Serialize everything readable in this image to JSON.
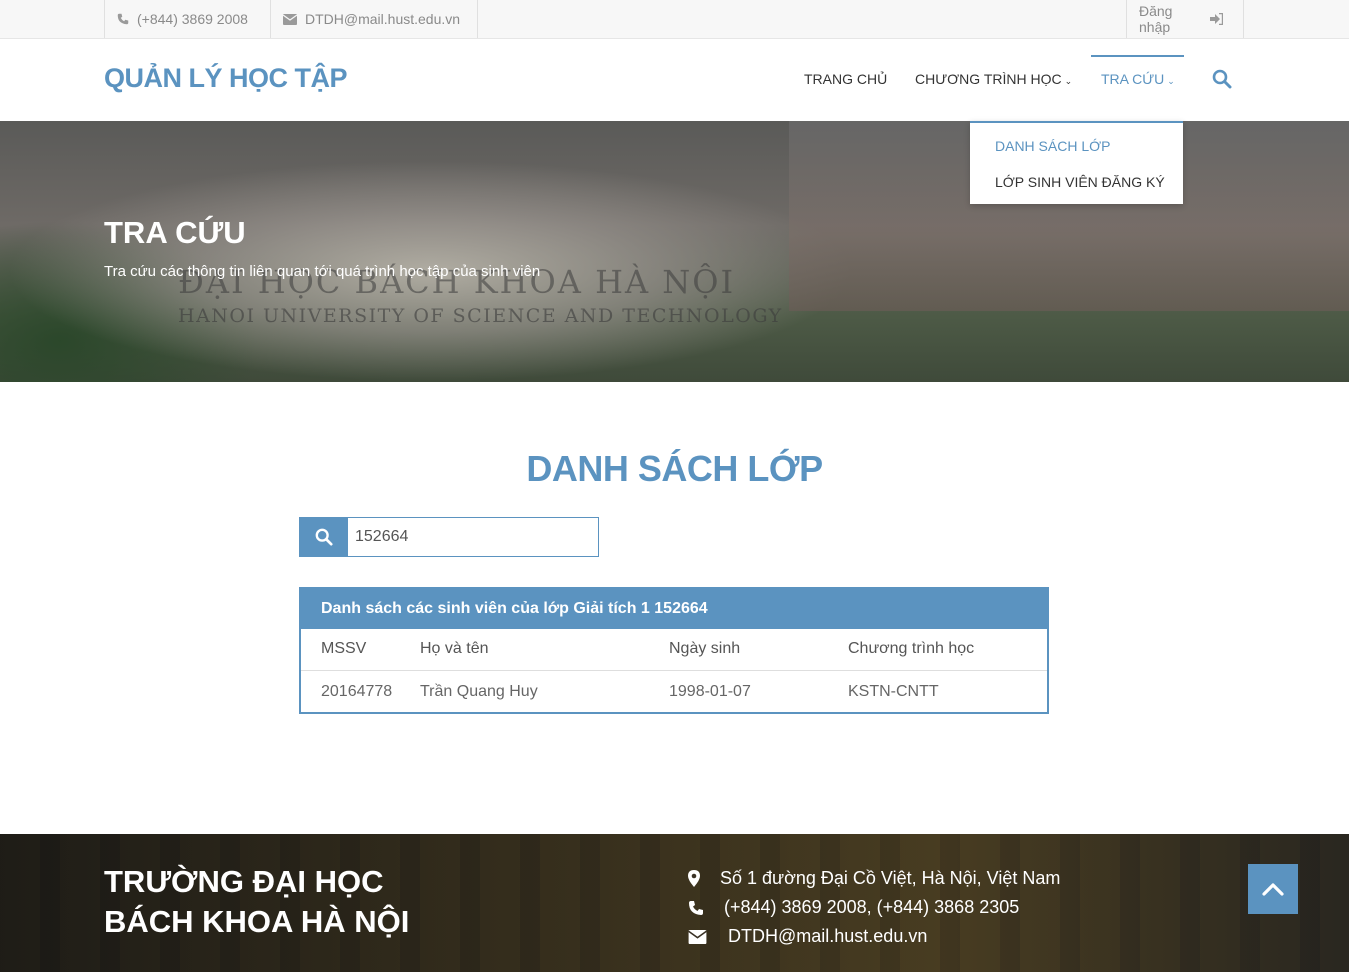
{
  "topbar": {
    "phone": "(+844) 3869 2008",
    "email": "DTDH@mail.hust.edu.vn",
    "login": "Đăng nhập"
  },
  "header": {
    "logo": "QUẢN LÝ HỌC TẬP",
    "nav": {
      "home": "TRANG CHỦ",
      "program": "CHƯƠNG TRÌNH HỌC",
      "lookup": "TRA CỨU"
    }
  },
  "dropdown": {
    "items": [
      "DANH SÁCH LỚP",
      "LỚP SINH VIÊN ĐĂNG KÝ"
    ]
  },
  "hero": {
    "title": "TRA CỨU",
    "subtitle": "Tra cứu các thông tin liên quan tới quá trình học tập của sinh viên",
    "stone_line1": "ĐẠI HỌC BÁCH KHOA HÀ NỘI",
    "stone_line2": "HANOI UNIVERSITY OF SCIENCE AND TECHNOLOGY"
  },
  "main": {
    "title": "DANH SÁCH LỚP",
    "search_value": "152664",
    "panel_title": "Danh sách các sinh viên của lớp Giải tích 1 152664",
    "table": {
      "headers": [
        "MSSV",
        "Họ và tên",
        "Ngày sinh",
        "Chương trình học"
      ],
      "rows": [
        [
          "20164778",
          "Trần Quang Huy",
          "1998-01-07",
          "KSTN-CNTT"
        ]
      ]
    }
  },
  "footer": {
    "title_line1": "TRƯỜNG ĐẠI HỌC",
    "title_line2": "BÁCH KHOA HÀ NỘI",
    "address": "Số 1 đường Đại Cồ Việt, Hà Nội, Việt Nam",
    "phones": "(+844) 3869 2008, (+844) 3868 2305",
    "email": "DTDH@mail.hust.edu.vn"
  },
  "colors": {
    "accent": "#5b93c0",
    "topbar_bg": "#f7f7f7"
  }
}
